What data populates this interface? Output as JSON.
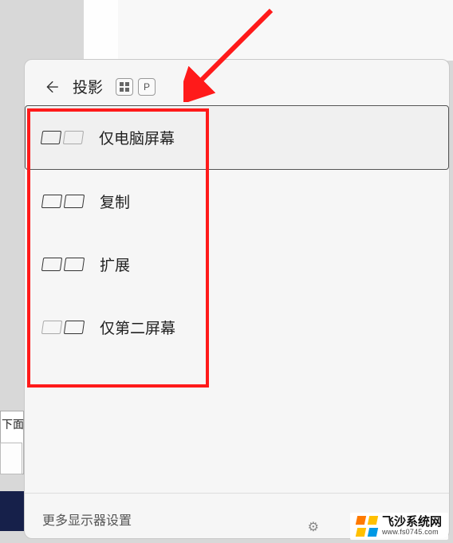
{
  "bg": {
    "label": "下面"
  },
  "arrow_color": "#ff1a1a",
  "header": {
    "title": "投影",
    "shortcut_key": "P"
  },
  "options": [
    {
      "label": "仅电脑屏幕",
      "left_on": true,
      "right_on": false,
      "selected": true
    },
    {
      "label": "复制",
      "left_on": true,
      "right_on": true,
      "selected": false
    },
    {
      "label": "扩展",
      "left_on": true,
      "right_on": true,
      "selected": false
    },
    {
      "label": "仅第二屏幕",
      "left_on": false,
      "right_on": true,
      "selected": false
    }
  ],
  "footer": {
    "more_settings": "更多显示器设置"
  },
  "watermark": {
    "title": "飞沙系统网",
    "url": "www.fs0745.com"
  }
}
